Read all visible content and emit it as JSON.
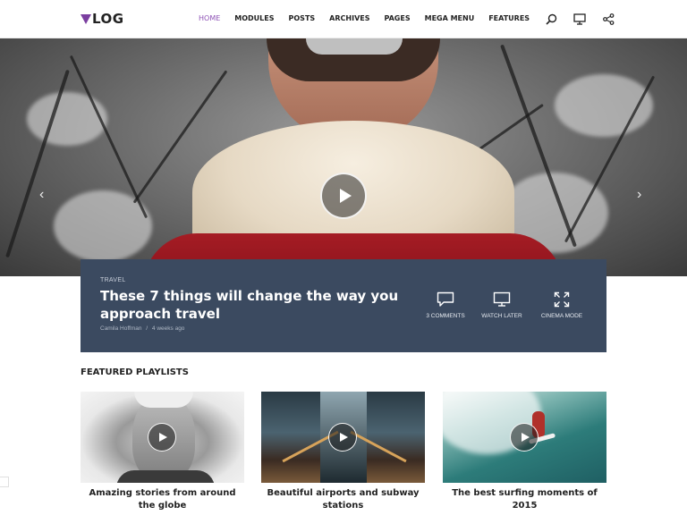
{
  "header": {
    "logo_text": "LOG",
    "brand_color": "#7b3fa0",
    "nav": [
      {
        "label": "HOME",
        "active": true
      },
      {
        "label": "MODULES"
      },
      {
        "label": "POSTS"
      },
      {
        "label": "ARCHIVES"
      },
      {
        "label": "PAGES"
      },
      {
        "label": "MEGA MENU"
      },
      {
        "label": "FEATURES"
      }
    ],
    "icons": [
      "search-icon",
      "monitor-icon",
      "share-icon"
    ]
  },
  "hero": {
    "prev_icon": "chevron-left-icon",
    "next_icon": "chevron-right-icon",
    "play_icon": "play-icon"
  },
  "featured_post": {
    "category": "TRAVEL",
    "title": "These 7 things will change the way you approach travel",
    "author": "Camila Hoffman",
    "separator": "/",
    "date": "4 weeks ago",
    "card_color": "#3b4a60",
    "actions": [
      {
        "label": "3 COMMENTS",
        "icon": "comment-icon"
      },
      {
        "label": "WATCH LATER",
        "icon": "monitor-icon"
      },
      {
        "label": "CINEMA MODE",
        "icon": "expand-icon"
      }
    ]
  },
  "playlists": {
    "section_title": "FEATURED PLAYLISTS",
    "items": [
      {
        "title": "Amazing stories from around the globe"
      },
      {
        "title": "Beautiful airports and subway stations"
      },
      {
        "title": "The best surfing moments of 2015"
      }
    ]
  }
}
